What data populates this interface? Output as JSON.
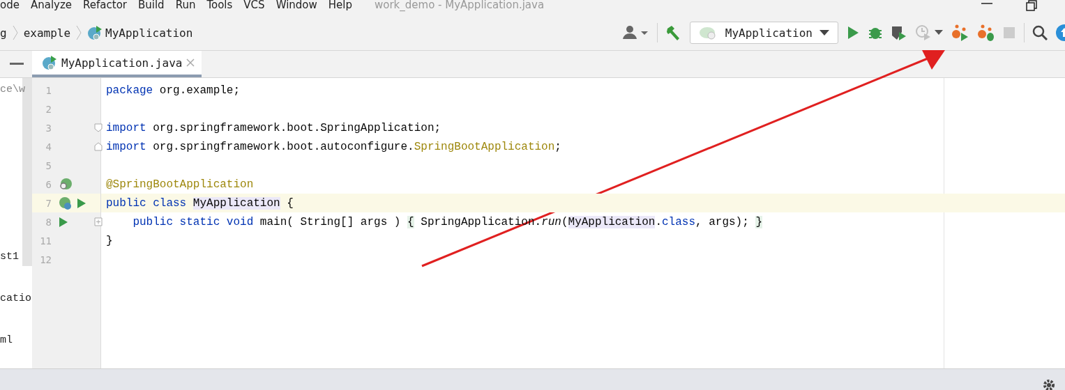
{
  "menu_bar": {
    "items": [
      "ode",
      "Analyze",
      "Refactor",
      "Build",
      "Run",
      "Tools",
      "VCS",
      "Window",
      "Help"
    ],
    "title": "work_demo - MyApplication.java"
  },
  "nav_bar": {
    "breadcrumbs": [
      "g",
      "example",
      "MyApplication"
    ],
    "run_config": "MyApplication",
    "toolbar": [
      {
        "kind": "user",
        "disabled": false
      },
      {
        "kind": "build",
        "disabled": false
      },
      {
        "kind": "config",
        "disabled": false
      },
      {
        "kind": "run",
        "disabled": false
      },
      {
        "kind": "debug",
        "disabled": false
      },
      {
        "kind": "coverage",
        "disabled": false
      },
      {
        "kind": "profile",
        "disabled": true
      },
      {
        "kind": "spring-run",
        "disabled": false
      },
      {
        "kind": "spring-debug",
        "disabled": false
      },
      {
        "kind": "stop",
        "disabled": true
      },
      {
        "kind": "search",
        "disabled": false
      },
      {
        "kind": "update",
        "disabled": false
      }
    ]
  },
  "tabs": [
    {
      "label": "MyApplication.java",
      "selected": true
    }
  ],
  "project_panel": {
    "items": [
      "ce\\w",
      "st1",
      "catio",
      "ml"
    ]
  },
  "editor": {
    "lines": [
      {
        "number": "1",
        "tokens": [
          {
            "kind": "keyword",
            "text": "package"
          },
          {
            "kind": "plain",
            "text": " org.example;"
          }
        ]
      },
      {
        "number": "2"
      },
      {
        "number": "3",
        "fold": {
          "kind": "start"
        },
        "tokens": [
          {
            "kind": "keyword",
            "text": "import"
          },
          {
            "kind": "plain",
            "text": " org.springframework.boot.SpringApplication;"
          }
        ]
      },
      {
        "number": "4",
        "fold": {
          "kind": "end"
        },
        "tokens": [
          {
            "kind": "keyword",
            "text": "import"
          },
          {
            "kind": "plain",
            "text": " org.springframework.boot.autoconfigure."
          },
          {
            "kind": "annotation",
            "text": "SpringBootApplication"
          },
          {
            "kind": "plain",
            "text": ";"
          }
        ]
      },
      {
        "number": "5"
      },
      {
        "number": "6",
        "markers": [
          {
            "kind": "bean"
          }
        ],
        "tokens": [
          {
            "kind": "annotation",
            "text": "@SpringBootApplication"
          }
        ]
      },
      {
        "number": "7",
        "current": true,
        "markers": [
          {
            "kind": "spring"
          },
          {
            "kind": "run"
          }
        ],
        "tokens": [
          {
            "kind": "keyword",
            "text": "public class "
          },
          {
            "kind": "ref",
            "text": "MyApplication"
          },
          {
            "kind": "plain",
            "text": " {"
          }
        ]
      },
      {
        "number": "8",
        "markers": [
          {
            "kind": "run"
          }
        ],
        "fold": {
          "kind": "collapsed"
        },
        "tokens": [
          {
            "kind": "keyword",
            "text": "    public static void"
          },
          {
            "kind": "plain",
            "text": " main( String[] args ) "
          },
          {
            "kind": "brace",
            "text": "{"
          },
          {
            "kind": "plain",
            "text": " SpringApplication."
          },
          {
            "kind": "italic",
            "text": "run"
          },
          {
            "kind": "plain",
            "text": "("
          },
          {
            "kind": "ref",
            "text": "MyApplication"
          },
          {
            "kind": "plain",
            "text": "."
          },
          {
            "kind": "keyword",
            "text": "class"
          },
          {
            "kind": "plain",
            "text": ", args); "
          },
          {
            "kind": "brace",
            "text": "}"
          }
        ]
      },
      {
        "number": "11",
        "tokens": [
          {
            "kind": "plain",
            "text": "}"
          }
        ]
      },
      {
        "number": "12"
      }
    ]
  }
}
